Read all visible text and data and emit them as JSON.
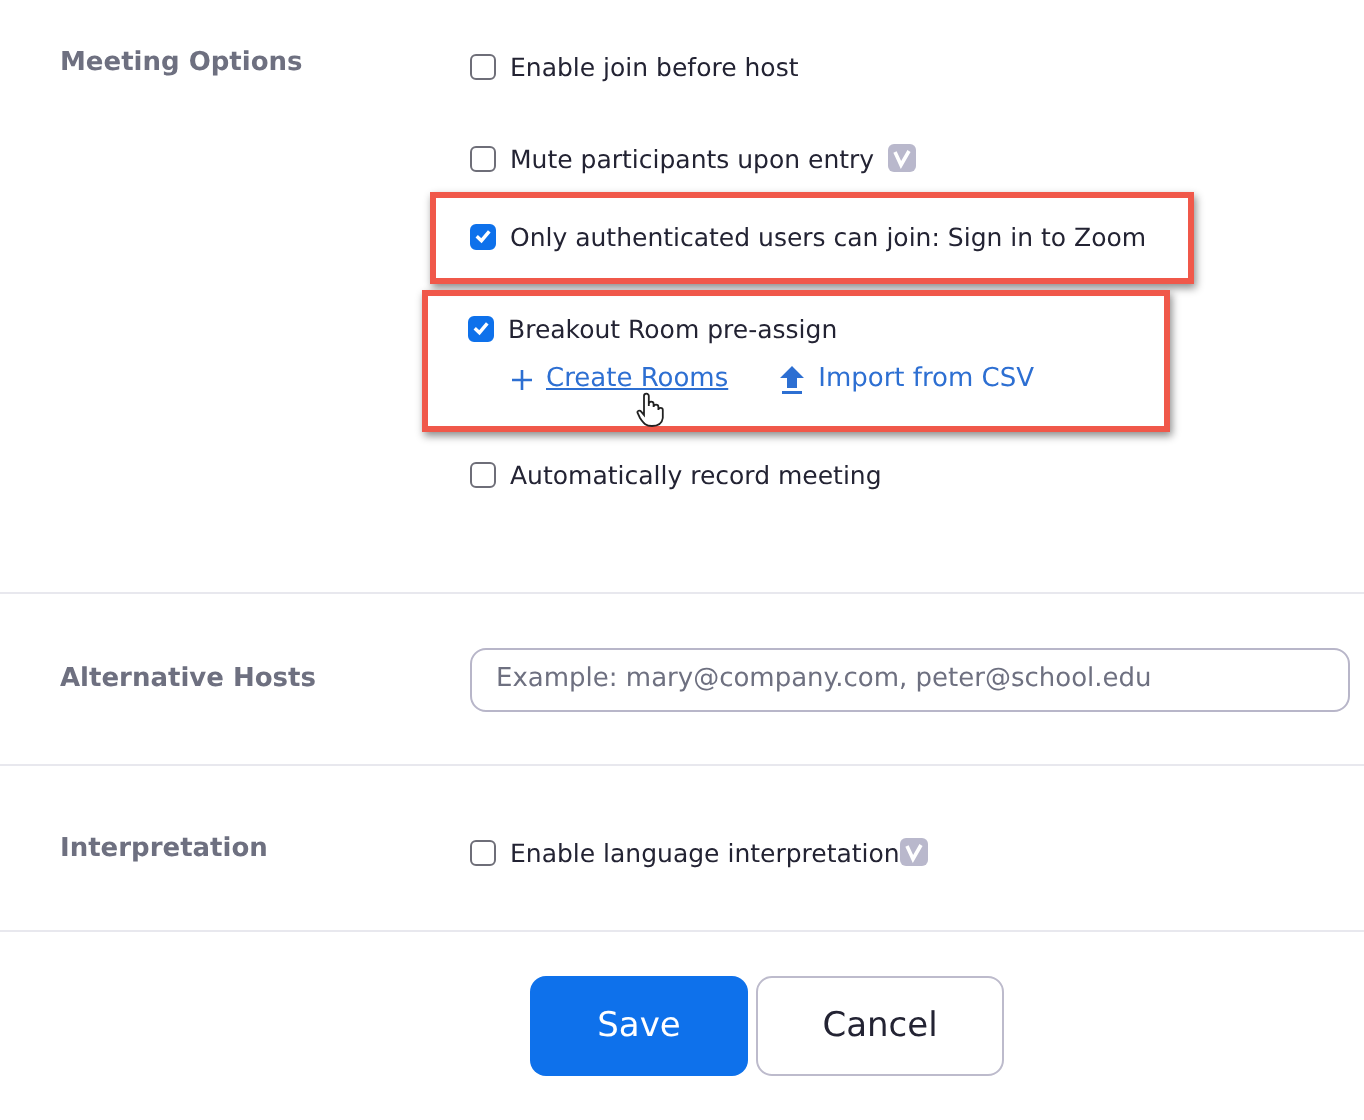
{
  "sections": [
    {
      "label": "Meeting Options",
      "kind": "options",
      "options": [
        {
          "label": "Enable join before host",
          "checked": false,
          "highlighted": false,
          "badge": false
        },
        {
          "label": "Mute participants upon entry",
          "checked": false,
          "highlighted": false,
          "badge": true
        },
        {
          "label": "Only authenticated users can join: Sign in to Zoom",
          "checked": true,
          "highlighted": true,
          "badge": false
        },
        {
          "label": "Breakout Room pre-assign",
          "checked": true,
          "highlighted": true,
          "badge": false,
          "links": [
            {
              "label": "Create Rooms",
              "kind": "add",
              "hovered": true
            },
            {
              "label": "Import from CSV",
              "kind": "upload",
              "hovered": false
            }
          ]
        },
        {
          "label": "Automatically record meeting",
          "checked": false,
          "highlighted": false,
          "badge": false
        }
      ]
    },
    {
      "label": "Alternative Hosts",
      "kind": "input",
      "placeholder": "Example: mary@company.com, peter@school.edu"
    },
    {
      "label": "Interpretation",
      "kind": "options",
      "options": [
        {
          "label": "Enable language interpretation",
          "checked": false,
          "highlighted": false,
          "badge": true
        }
      ]
    }
  ],
  "buttons": [
    {
      "label": "Save",
      "kind": "primary"
    },
    {
      "label": "Cancel",
      "kind": "secondary"
    }
  ]
}
